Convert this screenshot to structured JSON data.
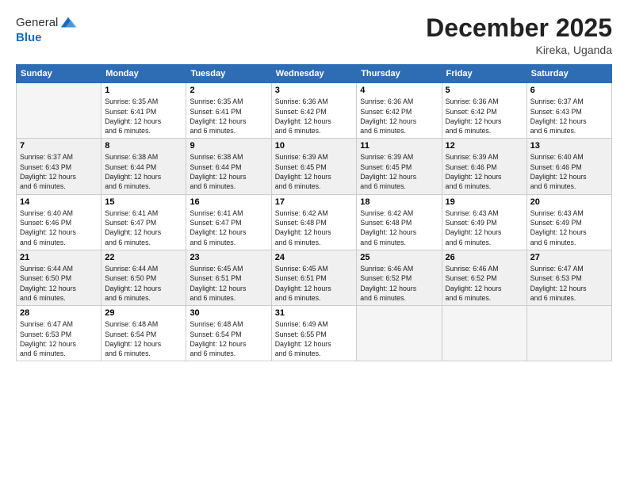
{
  "header": {
    "logo_general": "General",
    "logo_blue": "Blue",
    "month_title": "December 2025",
    "location": "Kireka, Uganda"
  },
  "days_of_week": [
    "Sunday",
    "Monday",
    "Tuesday",
    "Wednesday",
    "Thursday",
    "Friday",
    "Saturday"
  ],
  "weeks": [
    [
      {
        "day": "",
        "info": ""
      },
      {
        "day": "1",
        "info": "Sunrise: 6:35 AM\nSunset: 6:41 PM\nDaylight: 12 hours\nand 6 minutes."
      },
      {
        "day": "2",
        "info": "Sunrise: 6:35 AM\nSunset: 6:41 PM\nDaylight: 12 hours\nand 6 minutes."
      },
      {
        "day": "3",
        "info": "Sunrise: 6:36 AM\nSunset: 6:42 PM\nDaylight: 12 hours\nand 6 minutes."
      },
      {
        "day": "4",
        "info": "Sunrise: 6:36 AM\nSunset: 6:42 PM\nDaylight: 12 hours\nand 6 minutes."
      },
      {
        "day": "5",
        "info": "Sunrise: 6:36 AM\nSunset: 6:42 PM\nDaylight: 12 hours\nand 6 minutes."
      },
      {
        "day": "6",
        "info": "Sunrise: 6:37 AM\nSunset: 6:43 PM\nDaylight: 12 hours\nand 6 minutes."
      }
    ],
    [
      {
        "day": "7",
        "info": "Sunrise: 6:37 AM\nSunset: 6:43 PM\nDaylight: 12 hours\nand 6 minutes."
      },
      {
        "day": "8",
        "info": "Sunrise: 6:38 AM\nSunset: 6:44 PM\nDaylight: 12 hours\nand 6 minutes."
      },
      {
        "day": "9",
        "info": "Sunrise: 6:38 AM\nSunset: 6:44 PM\nDaylight: 12 hours\nand 6 minutes."
      },
      {
        "day": "10",
        "info": "Sunrise: 6:39 AM\nSunset: 6:45 PM\nDaylight: 12 hours\nand 6 minutes."
      },
      {
        "day": "11",
        "info": "Sunrise: 6:39 AM\nSunset: 6:45 PM\nDaylight: 12 hours\nand 6 minutes."
      },
      {
        "day": "12",
        "info": "Sunrise: 6:39 AM\nSunset: 6:46 PM\nDaylight: 12 hours\nand 6 minutes."
      },
      {
        "day": "13",
        "info": "Sunrise: 6:40 AM\nSunset: 6:46 PM\nDaylight: 12 hours\nand 6 minutes."
      }
    ],
    [
      {
        "day": "14",
        "info": "Sunrise: 6:40 AM\nSunset: 6:46 PM\nDaylight: 12 hours\nand 6 minutes."
      },
      {
        "day": "15",
        "info": "Sunrise: 6:41 AM\nSunset: 6:47 PM\nDaylight: 12 hours\nand 6 minutes."
      },
      {
        "day": "16",
        "info": "Sunrise: 6:41 AM\nSunset: 6:47 PM\nDaylight: 12 hours\nand 6 minutes."
      },
      {
        "day": "17",
        "info": "Sunrise: 6:42 AM\nSunset: 6:48 PM\nDaylight: 12 hours\nand 6 minutes."
      },
      {
        "day": "18",
        "info": "Sunrise: 6:42 AM\nSunset: 6:48 PM\nDaylight: 12 hours\nand 6 minutes."
      },
      {
        "day": "19",
        "info": "Sunrise: 6:43 AM\nSunset: 6:49 PM\nDaylight: 12 hours\nand 6 minutes."
      },
      {
        "day": "20",
        "info": "Sunrise: 6:43 AM\nSunset: 6:49 PM\nDaylight: 12 hours\nand 6 minutes."
      }
    ],
    [
      {
        "day": "21",
        "info": "Sunrise: 6:44 AM\nSunset: 6:50 PM\nDaylight: 12 hours\nand 6 minutes."
      },
      {
        "day": "22",
        "info": "Sunrise: 6:44 AM\nSunset: 6:50 PM\nDaylight: 12 hours\nand 6 minutes."
      },
      {
        "day": "23",
        "info": "Sunrise: 6:45 AM\nSunset: 6:51 PM\nDaylight: 12 hours\nand 6 minutes."
      },
      {
        "day": "24",
        "info": "Sunrise: 6:45 AM\nSunset: 6:51 PM\nDaylight: 12 hours\nand 6 minutes."
      },
      {
        "day": "25",
        "info": "Sunrise: 6:46 AM\nSunset: 6:52 PM\nDaylight: 12 hours\nand 6 minutes."
      },
      {
        "day": "26",
        "info": "Sunrise: 6:46 AM\nSunset: 6:52 PM\nDaylight: 12 hours\nand 6 minutes."
      },
      {
        "day": "27",
        "info": "Sunrise: 6:47 AM\nSunset: 6:53 PM\nDaylight: 12 hours\nand 6 minutes."
      }
    ],
    [
      {
        "day": "28",
        "info": "Sunrise: 6:47 AM\nSunset: 6:53 PM\nDaylight: 12 hours\nand 6 minutes."
      },
      {
        "day": "29",
        "info": "Sunrise: 6:48 AM\nSunset: 6:54 PM\nDaylight: 12 hours\nand 6 minutes."
      },
      {
        "day": "30",
        "info": "Sunrise: 6:48 AM\nSunset: 6:54 PM\nDaylight: 12 hours\nand 6 minutes."
      },
      {
        "day": "31",
        "info": "Sunrise: 6:49 AM\nSunset: 6:55 PM\nDaylight: 12 hours\nand 6 minutes."
      },
      {
        "day": "",
        "info": ""
      },
      {
        "day": "",
        "info": ""
      },
      {
        "day": "",
        "info": ""
      }
    ]
  ]
}
